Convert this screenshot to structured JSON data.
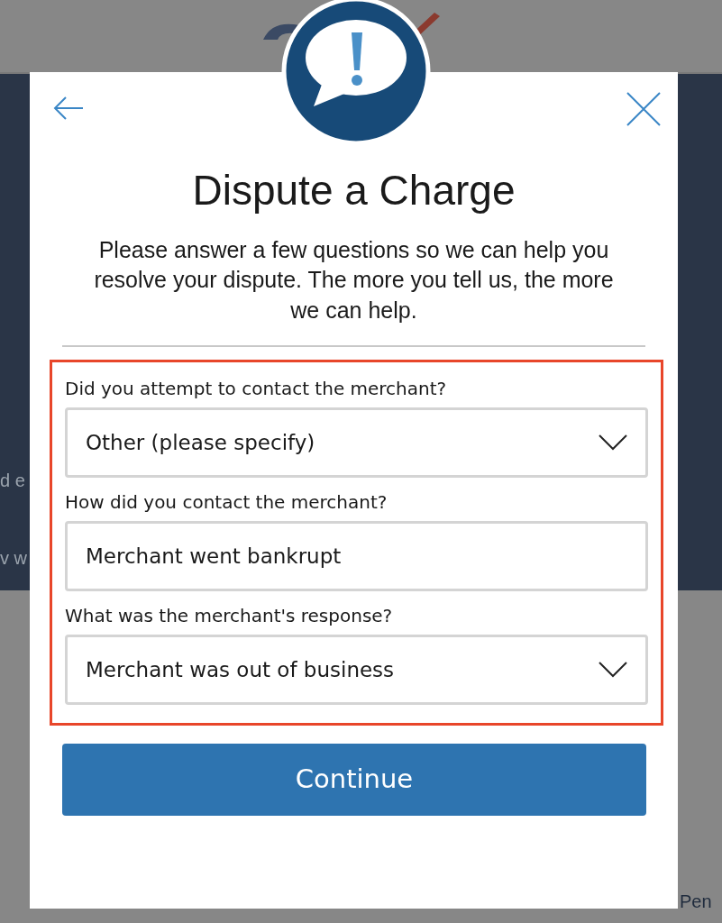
{
  "background": {
    "fragments": [
      "d e",
      "v w",
      "Pen"
    ]
  },
  "dialog": {
    "title": "Dispute a Charge",
    "message": "Please answer a few questions so we can help you resolve your dispute. The more you tell us, the more we can help.",
    "form": {
      "highlighted": true,
      "questions": [
        {
          "label": "Did you attempt to contact the merchant?",
          "kind": "select",
          "value": "Other (please specify)"
        },
        {
          "label": "How did you contact the merchant?",
          "kind": "text",
          "value": "Merchant went bankrupt"
        },
        {
          "label": "What was the merchant's response?",
          "kind": "select",
          "value": "Merchant was out of business"
        }
      ]
    },
    "continue_button": "Continue"
  }
}
